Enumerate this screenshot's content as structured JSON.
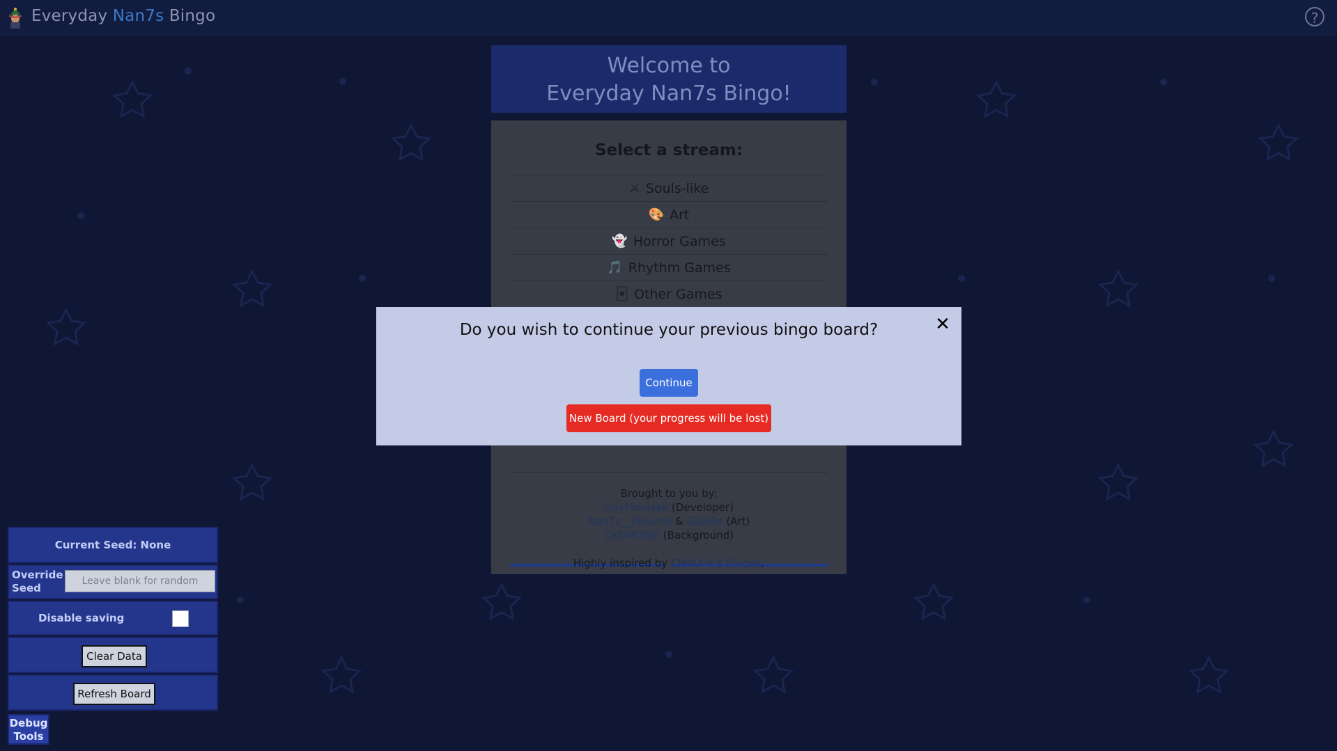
{
  "header": {
    "title_part1": "Everyday ",
    "title_part2": "Nan7s",
    "title_part3": " Bingo",
    "help_label": "?"
  },
  "welcome": {
    "line1": "Welcome to",
    "line2": "Everyday Nan7s Bingo!"
  },
  "stream_select": {
    "heading": "Select a stream:",
    "items": [
      {
        "icon": "swords-icon",
        "glyph": "⚔",
        "label": "Souls-like"
      },
      {
        "icon": "palette-icon",
        "glyph": "🎨",
        "label": "Art"
      },
      {
        "icon": "ghost-icon",
        "glyph": "👻",
        "label": "Horror Games"
      },
      {
        "icon": "music-note-icon",
        "glyph": "🎵",
        "label": "Rhythm Games"
      },
      {
        "icon": "card-icon",
        "glyph": "🃏",
        "label": "Other Games"
      }
    ]
  },
  "credits": {
    "intro": "Brought to you by:",
    "dev_name": "DayMoniakk",
    "dev_role": " (Developer)",
    "art_name1": "Nan7s__Peluche",
    "amp": " & ",
    "art_name2": "Gluelle",
    "art_role": " (Art)",
    "bg_name": "OKUMONO",
    "bg_role": " (Background)",
    "inspired_prefix": "Highly inspired by ",
    "inspired_link": "CJMAXiK's Bingos",
    "inspired_suffix": "."
  },
  "modal": {
    "question": "Do you wish to continue your previous bingo board?",
    "close_label": "✕",
    "continue_label": "Continue",
    "new_board_label": "New Board (your progress will be lost)"
  },
  "debug": {
    "current_seed": "Current Seed: None",
    "override_label": "Override Seed",
    "override_placeholder": "Leave blank for random",
    "disable_saving_label": "Disable saving",
    "clear_label": "Clear Data",
    "refresh_label": "Refresh Board",
    "toggle_label": "Debug Tools"
  },
  "colors": {
    "background": "#0f1734",
    "accent": "#3a78c7",
    "continue": "#3b6fdc",
    "danger": "#e62b24"
  }
}
